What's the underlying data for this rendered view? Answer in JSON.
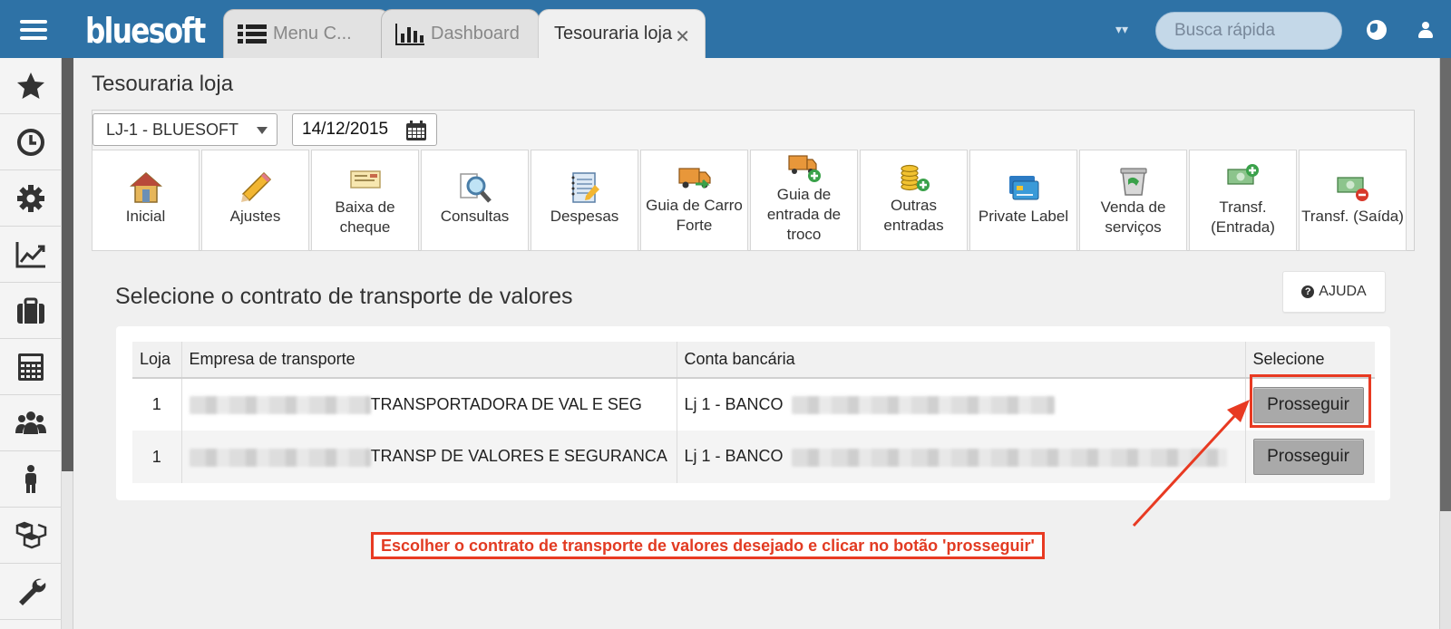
{
  "app": {
    "logo": "bluesoft",
    "search_placeholder": "Busca rápida"
  },
  "tabs": [
    {
      "label": "Menu C...",
      "icon": "list-icon"
    },
    {
      "label": "Dashboard",
      "icon": "bar-chart-icon"
    },
    {
      "label": "Tesouraria loja",
      "icon": "close-icon"
    }
  ],
  "sidebar": {
    "items": [
      "star-icon",
      "clock-icon",
      "gear-icon",
      "line-chart-icon",
      "briefcase-icon",
      "calculator-icon",
      "users-icon",
      "person-icon",
      "boxes-icon",
      "wrench-icon"
    ]
  },
  "page": {
    "title": "Tesouraria loja",
    "store": "LJ-1 - BLUESOFT",
    "date": "14/12/2015"
  },
  "actions": [
    {
      "label": "Inicial",
      "icon": "house-icon"
    },
    {
      "label": "Ajustes",
      "icon": "pencil-icon"
    },
    {
      "label": "Baixa de cheque",
      "icon": "check-document-icon"
    },
    {
      "label": "Consultas",
      "icon": "magnifier-icon"
    },
    {
      "label": "Despesas",
      "icon": "notebook-icon"
    },
    {
      "label": "Guia de Carro Forte",
      "icon": "truck-icon"
    },
    {
      "label": "Guia de entrada de troco",
      "icon": "truck-add-icon"
    },
    {
      "label": "Outras entradas",
      "icon": "coins-add-icon"
    },
    {
      "label": "Private Label",
      "icon": "cards-icon"
    },
    {
      "label": "Venda de serviços",
      "icon": "bin-icon"
    },
    {
      "label": "Transf. (Entrada)",
      "icon": "money-add-icon"
    },
    {
      "label": "Transf. (Saída)",
      "icon": "money-remove-icon"
    }
  ],
  "section": {
    "title": "Selecione o contrato de transporte de valores",
    "help_label": "AJUDA"
  },
  "table": {
    "headers": [
      "Loja",
      "Empresa de transporte",
      "Conta bancária",
      "Selecione"
    ],
    "rows": [
      {
        "loja": "1",
        "empresa": "TRANSPORTADORA DE VAL E SEG",
        "conta": "Lj 1 - BANCO",
        "button": "Prosseguir"
      },
      {
        "loja": "1",
        "empresa": "TRANSP DE VALORES E SEGURANCA",
        "conta": "Lj 1 - BANCO",
        "button": "Prosseguir"
      }
    ]
  },
  "annotation": {
    "text": "Escolher o contrato de transporte de valores desejado e clicar no botão 'prosseguir'",
    "color": "#e23b22"
  },
  "colors": {
    "topbar": "#2e72a6",
    "annotation_red": "#e83a22"
  }
}
